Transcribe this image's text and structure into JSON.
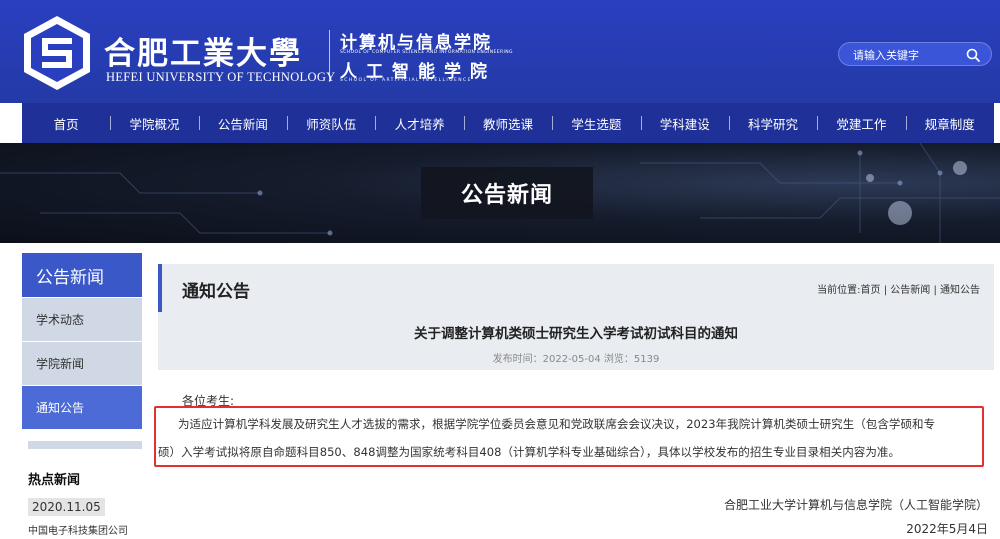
{
  "header": {
    "univ_cn": "合肥工業大學",
    "univ_en": "HEFEI UNIVERSITY OF TECHNOLOGY",
    "school1": "计算机与信息学院",
    "school1_en": "SCHOOL OF COMPUTER SCIENCE AND INFORMATION ENGINEERING",
    "school2": "人工智能学院",
    "school2_en": "SCHOOL OF ARTIFICIAL INTELLIGENCE",
    "search_placeholder": "请输入关键字"
  },
  "nav": {
    "items": [
      "首页",
      "学院概况",
      "公告新闻",
      "师资队伍",
      "人才培养",
      "教师选课",
      "学生选题",
      "学科建设",
      "科学研究",
      "党建工作",
      "规章制度"
    ]
  },
  "banner": {
    "title": "公告新闻"
  },
  "sidebar": {
    "title": "公告新闻",
    "items": [
      {
        "label": "学术动态"
      },
      {
        "label": "学院新闻"
      },
      {
        "label": "通知公告"
      }
    ],
    "hot_title": "热点新闻",
    "hot_date": "2020.11.05",
    "hot_item": "中国电子科技集团公司"
  },
  "main": {
    "section_title": "通知公告",
    "breadcrumb": {
      "prefix": "当前位置:",
      "home": "首页",
      "sep1": " | ",
      "news": "公告新闻",
      "sep2": " | ",
      "notice": "通知公告"
    },
    "article": {
      "title": "关于调整计算机类硕士研究生入学考试初试科目的通知",
      "meta": "发布时间：2022-05-04 浏览：5139",
      "greeting": "各位考生:",
      "para1": "为适应计算机学科发展及研究生人才选拔的需求，根据学院学位委员会意见和党政联席会会议决议，2023年我院计算机类硕士研究生（包含学硕和专",
      "para2": "硕）入学考试拟将原自命题科目850、848调整为国家统考科目408（计算机学科专业基础综合），具体以学校发布的招生专业目录相关内容为准。",
      "signature": "合肥工业大学计算机与信息学院（人工智能学院）",
      "date": "2022年5月4日"
    }
  },
  "colors": {
    "header_blue": "#2a3fc0",
    "nav_blue": "#1f3199",
    "accent_blue": "#3a58c8",
    "highlight_red": "#e03030"
  }
}
